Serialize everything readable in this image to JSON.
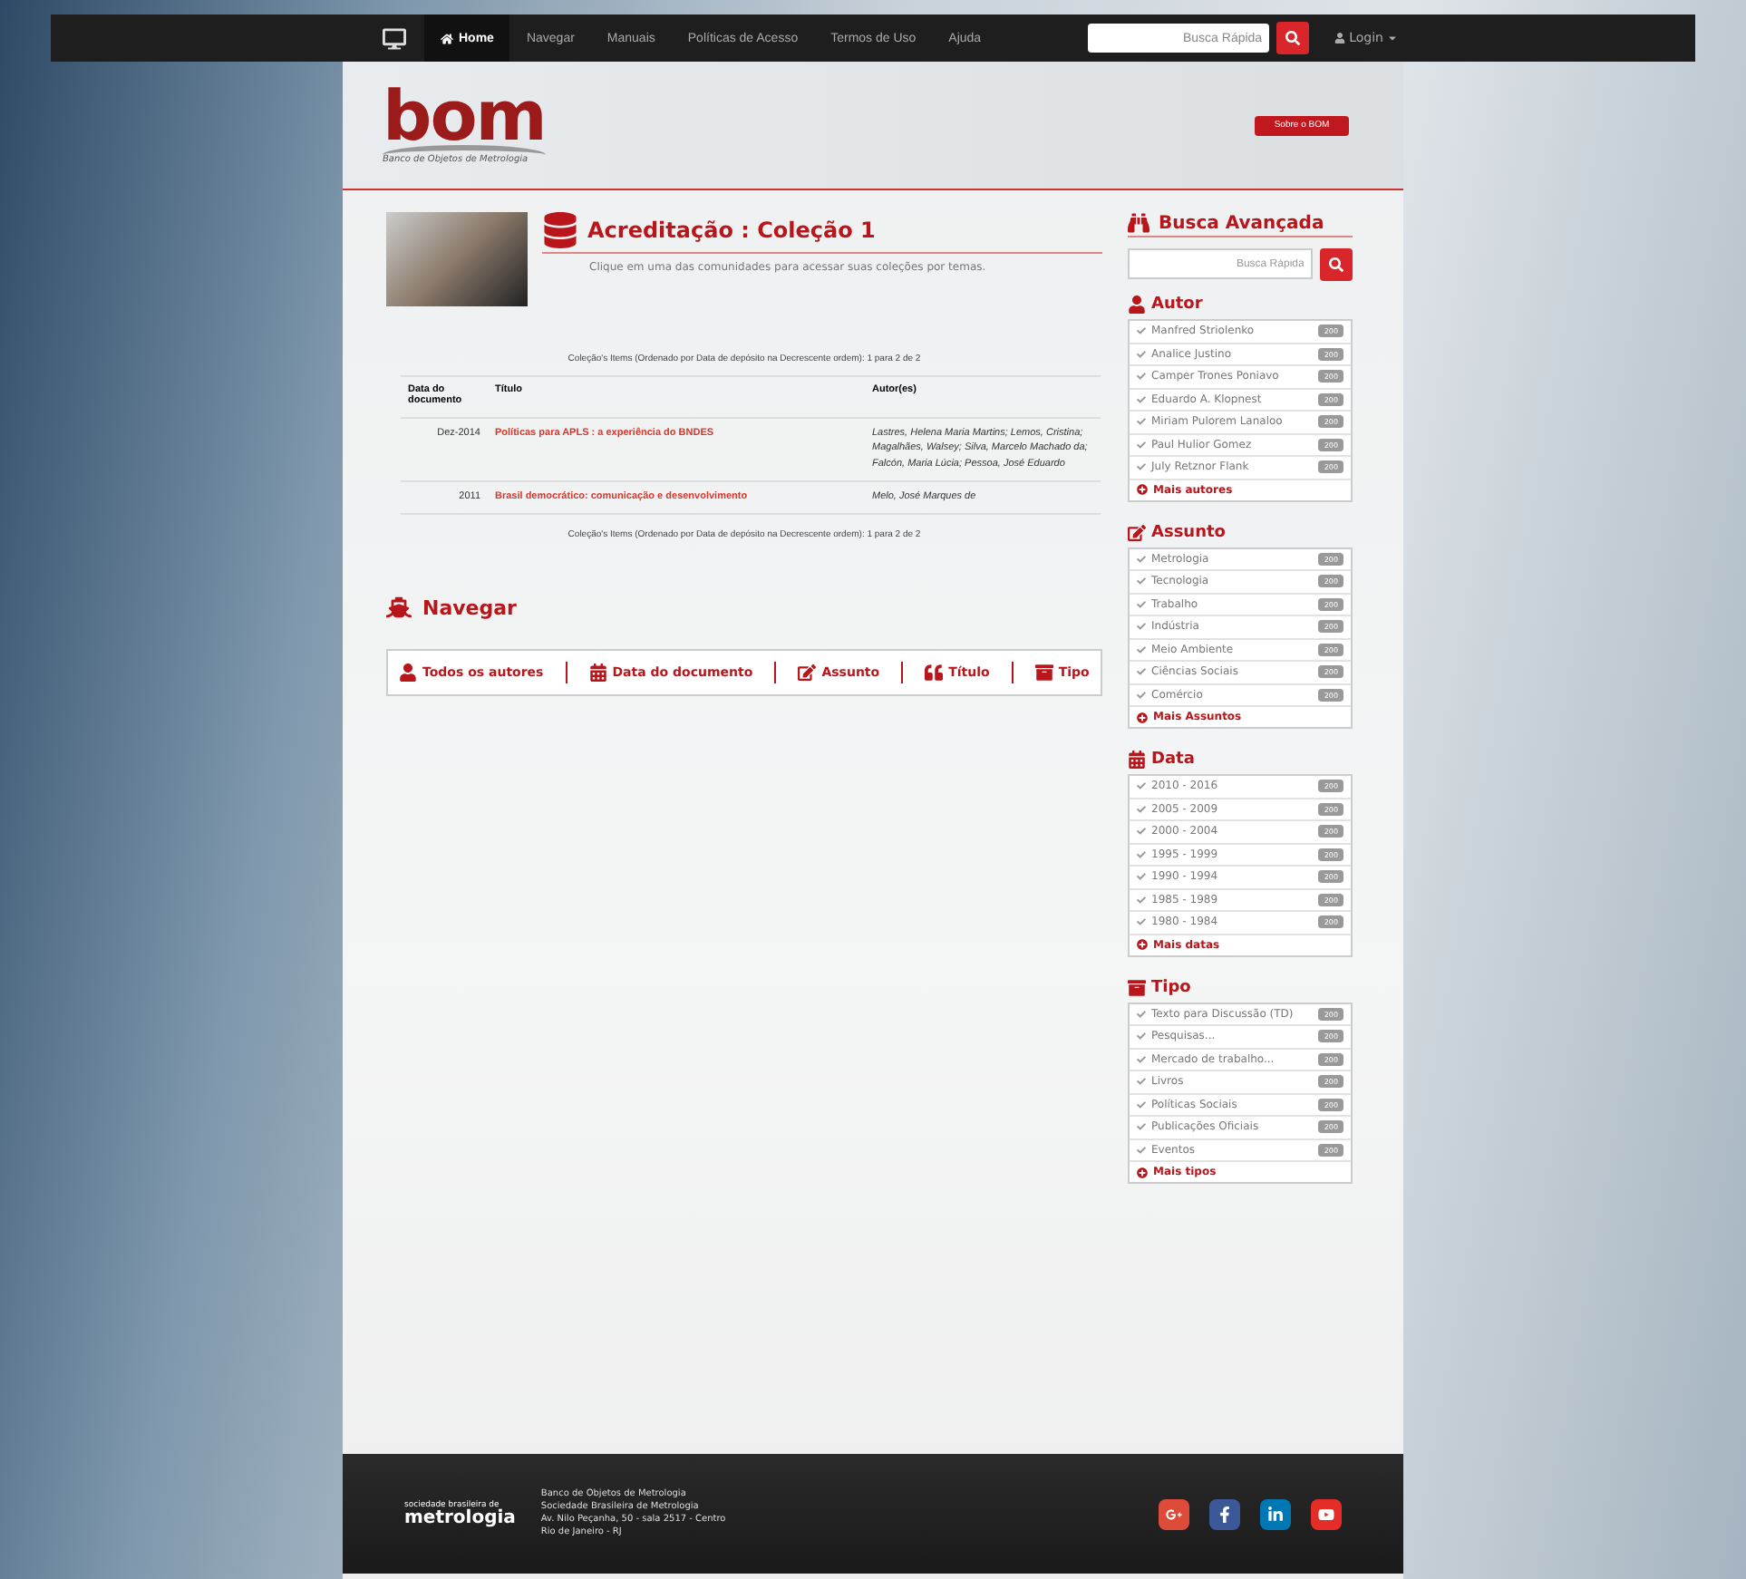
{
  "navbar": {
    "items": [
      {
        "label": "Home",
        "selected": true
      },
      {
        "label": "Navegar",
        "selected": false
      },
      {
        "label": "Manuais",
        "selected": false
      },
      {
        "label": "Políticas de Acesso",
        "selected": false
      },
      {
        "label": "Termos de Uso",
        "selected": false
      },
      {
        "label": "Ajuda",
        "selected": false
      }
    ],
    "search": {
      "placeholder": "Busca Rápida"
    },
    "login": "Login"
  },
  "header": {
    "logo": "bom",
    "logo_subtitle": "Banco de Objetos de Metrologia",
    "about_button": "Sobre o BOM"
  },
  "collection": {
    "title": "Acreditação : Coleção 1",
    "subtitle": "Clique em uma das comunidades para acessar suas coleções por temas.",
    "caption_top": "Coleção's Items (Ordenado por Data de depósito na Decrescente ordem): 1 para 2 de 2",
    "caption_bottom": "Coleção's Items (Ordenado por Data de depósito na Decrescente ordem): 1 para 2 de 2",
    "columns": [
      "Data do documento",
      "Título",
      "Autor(es)"
    ],
    "rows": [
      {
        "date": "Dez-2014",
        "title": "Políticas para APLS : a experiência do BNDES",
        "authors": "Lastres, Helena Maria Martins; Lemos, Cristina; Magalhães, Walsey; Silva, Marcelo Machado da; Falcón, Maria Lúcia; Pessoa, José Eduardo"
      },
      {
        "date": "2011",
        "title": "Brasil democrático: comunicação e desenvolvimento",
        "authors": "Melo, José Marques de"
      }
    ]
  },
  "browse": {
    "title": "Navegar",
    "items": [
      {
        "kind": "author",
        "label": "Todos os autores"
      },
      {
        "kind": "date",
        "label": "Data do documento"
      },
      {
        "kind": "subject",
        "label": "Assunto"
      },
      {
        "kind": "title",
        "label": "Título"
      },
      {
        "kind": "type",
        "label": "Tipo"
      }
    ]
  },
  "sidebar": {
    "title": "Busca Avançada",
    "search": {
      "placeholder": "Busca Rápida"
    },
    "facets": [
      {
        "kind": "author",
        "title": "Autor",
        "items": [
          {
            "label": "Manfred Striolenko",
            "count": "200"
          },
          {
            "label": "Analice Justino",
            "count": "200"
          },
          {
            "label": "Camper Trones Poniavo",
            "count": "200"
          },
          {
            "label": "Eduardo A. Klopnest",
            "count": "200"
          },
          {
            "label": "Miriam Pulorem Lanaloo",
            "count": "200"
          },
          {
            "label": "Paul Hulior Gomez",
            "count": "200"
          },
          {
            "label": "July Retznor Flank",
            "count": "200"
          }
        ],
        "more": "Mais autores"
      },
      {
        "kind": "subject",
        "title": "Assunto",
        "items": [
          {
            "label": "Metrologia",
            "count": "200"
          },
          {
            "label": "Tecnologia",
            "count": "200"
          },
          {
            "label": "Trabalho",
            "count": "200"
          },
          {
            "label": "Indústria",
            "count": "200"
          },
          {
            "label": "Meio Ambiente",
            "count": "200"
          },
          {
            "label": "Ciências Sociais",
            "count": "200"
          },
          {
            "label": "Comércio",
            "count": "200"
          }
        ],
        "more": "Mais Assuntos"
      },
      {
        "kind": "date",
        "title": "Data",
        "items": [
          {
            "label": "2010 - 2016",
            "count": "200"
          },
          {
            "label": "2005 - 2009",
            "count": "200"
          },
          {
            "label": "2000 - 2004",
            "count": "200"
          },
          {
            "label": "1995 - 1999",
            "count": "200"
          },
          {
            "label": "1990 - 1994",
            "count": "200"
          },
          {
            "label": "1985 - 1989",
            "count": "200"
          },
          {
            "label": "1980 - 1984",
            "count": "200"
          }
        ],
        "more": "Mais datas"
      },
      {
        "kind": "type",
        "title": "Tipo",
        "items": [
          {
            "label": "Texto para Discussão (TD)",
            "count": "200"
          },
          {
            "label": "Pesquisas...",
            "count": "200"
          },
          {
            "label": "Mercado de trabalho...",
            "count": "200"
          },
          {
            "label": "Livros",
            "count": "200"
          },
          {
            "label": "Políticas Sociais",
            "count": "200"
          },
          {
            "label": "Publicações Oficiais",
            "count": "200"
          },
          {
            "label": "Eventos",
            "count": "200"
          }
        ],
        "more": "Mais tipos"
      }
    ]
  },
  "footer": {
    "logo_top": "sociedade brasileira de",
    "logo_bottom": "metrologia",
    "lines": [
      "Banco de Objetos de Metrologia",
      "Sociedade Brasileira de Metrologia",
      "Av. Nilo Peçanha, 50 - sala 2517 - Centro",
      "Rio de Janeiro - RJ"
    ]
  }
}
